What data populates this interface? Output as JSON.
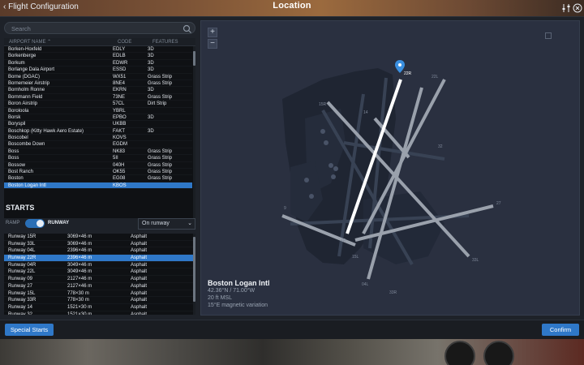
{
  "header": {
    "back_label": "Flight Configuration",
    "title": "Location"
  },
  "search": {
    "placeholder": "Search"
  },
  "airport_table": {
    "columns": [
      "AIRPORT NAME",
      "CODE",
      "FEATURES"
    ],
    "rows": [
      [
        "Borken-Hoxfeld",
        "EDLY",
        "3D"
      ],
      [
        "Borkenberge",
        "EDLB",
        "3D"
      ],
      [
        "Borkum",
        "EDWR",
        "3D"
      ],
      [
        "Borlange Dala Airport",
        "ESSD",
        "3D"
      ],
      [
        "Borne (DGAC)",
        "WX51",
        "Grass Strip"
      ],
      [
        "Bornemeier Airstrip",
        "8NE4",
        "Grass Strip"
      ],
      [
        "Bornholm Ronne",
        "EKRN",
        "3D"
      ],
      [
        "Bornmann Field",
        "73NE",
        "Grass Strip"
      ],
      [
        "Boron Airstrip",
        "57CL",
        "Dirt Strip"
      ],
      [
        "Boroloola",
        "YBRL",
        ""
      ],
      [
        "Borsk",
        "EPBO",
        "3D"
      ],
      [
        "Boryspil",
        "UKBB",
        ""
      ],
      [
        "Boschkop (Kitty Hawk Aero Estate)",
        "FAKT",
        "3D"
      ],
      [
        "Boscobel",
        "KOVS",
        ""
      ],
      [
        "Boscombe Down",
        "EGDM",
        ""
      ],
      [
        "Boss",
        "NK83",
        "Grass Strip"
      ],
      [
        "Boss",
        "5II",
        "Grass Strip"
      ],
      [
        "Bossow",
        "040H",
        "Grass Strip"
      ],
      [
        "Bost Ranch",
        "OK55",
        "Grass Strip"
      ],
      [
        "Boston",
        "EG08",
        "Grass Strip"
      ],
      [
        "Boston Logan Intl",
        "KBOS",
        ""
      ]
    ],
    "selected_index": 20
  },
  "starts": {
    "title": "STARTS",
    "ramp_label": "RAMP",
    "runway_label": "RUNWAY",
    "dropdown_value": "On runway",
    "rows": [
      [
        "Runway 15R",
        "3069×46 m",
        "Asphalt"
      ],
      [
        "Runway 33L",
        "3069×46 m",
        "Asphalt"
      ],
      [
        "Runway 04L",
        "2396×46 m",
        "Asphalt"
      ],
      [
        "Runway 22R",
        "2396×46 m",
        "Asphalt"
      ],
      [
        "Runway 04R",
        "3049×46 m",
        "Asphalt"
      ],
      [
        "Runway 22L",
        "3049×46 m",
        "Asphalt"
      ],
      [
        "Runway 09",
        "2127×46 m",
        "Asphalt"
      ],
      [
        "Runway 27",
        "2127×46 m",
        "Asphalt"
      ],
      [
        "Runway 15L",
        "778×30 m",
        "Asphalt"
      ],
      [
        "Runway 33R",
        "778×30 m",
        "Asphalt"
      ],
      [
        "Runway 14",
        "1521×30 m",
        "Asphalt"
      ],
      [
        "Runway 32",
        "1521×30 m",
        "Asphalt"
      ]
    ],
    "selected_index": 3
  },
  "map": {
    "airport_name": "Boston Logan Intl",
    "coords": "42.36°N / 71.00°W",
    "elevation": "20 ft MSL",
    "variation": "15°E magnetic variation",
    "runway_labels": [
      "22R",
      "15R",
      "33L",
      "4R",
      "22L",
      "27",
      "9",
      "32",
      "14",
      "04L",
      "33R",
      "15L"
    ],
    "zoom_in": "+",
    "zoom_out": "−"
  },
  "buttons": {
    "special_starts": "Special Starts",
    "confirm": "Confirm"
  },
  "colors": {
    "accent": "#2f78c8",
    "map_bg": "#2a3040",
    "selected_runway": "#ffffff"
  }
}
